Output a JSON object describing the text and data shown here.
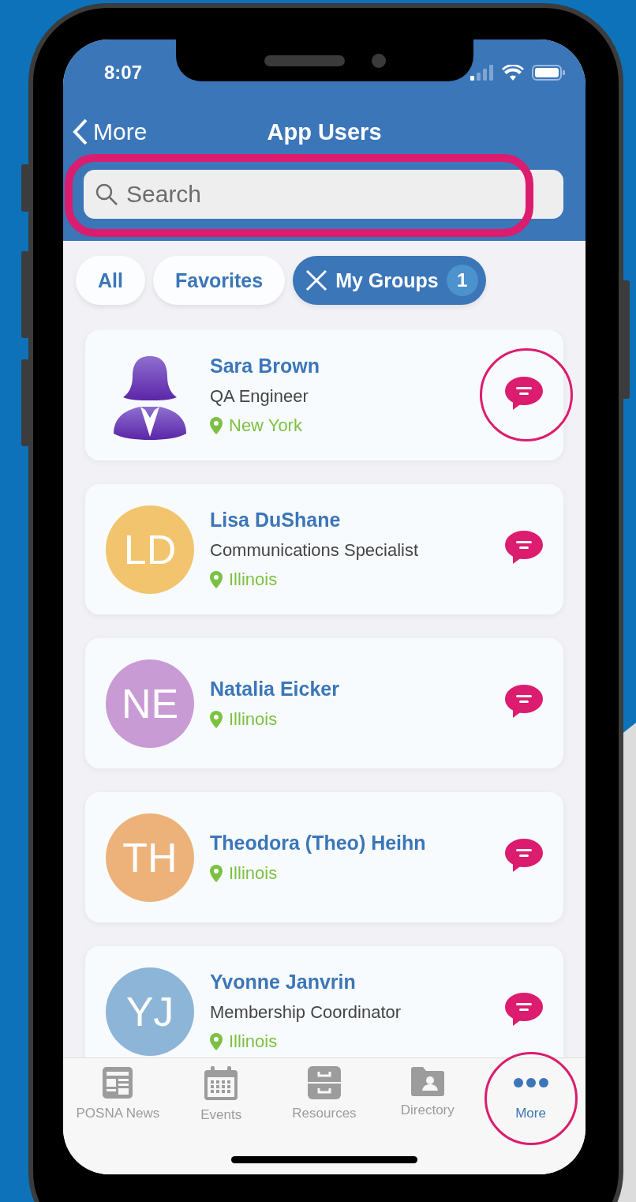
{
  "status_bar": {
    "time": "8:07"
  },
  "nav": {
    "back": "More",
    "title": "App Users"
  },
  "search": {
    "placeholder": "Search",
    "highlighted": true
  },
  "filters": [
    {
      "label": "All",
      "selected": false
    },
    {
      "label": "Favorites",
      "selected": false
    },
    {
      "label": "My Groups",
      "selected": true,
      "count": "1"
    }
  ],
  "users": [
    {
      "kind": "silhouette",
      "name": "Sara Brown",
      "title": "QA Engineer",
      "location": "New York",
      "highlighted": true
    },
    {
      "kind": "initials",
      "initials": "LD",
      "color": "#f2c46e",
      "name": "Lisa DuShane",
      "title": "Communications Specialist",
      "location": "Illinois",
      "highlighted": false
    },
    {
      "kind": "initials",
      "initials": "NE",
      "color": "#c99bd5",
      "name": "Natalia Eicker",
      "location": "Illinois",
      "highlighted": false
    },
    {
      "kind": "initials",
      "initials": "TH",
      "color": "#ecb27a",
      "name": "Theodora (Theo) Heihn",
      "location": "Illinois",
      "highlighted": false
    },
    {
      "kind": "initials",
      "initials": "YJ",
      "color": "#8db5d8",
      "name": "Yvonne Janvrin",
      "title": "Membership Coordinator",
      "location": "Illinois",
      "highlighted": false
    }
  ],
  "tabs": [
    {
      "kind": "news",
      "label": "POSNA News",
      "selected": false,
      "highlighted": false
    },
    {
      "kind": "calendar",
      "label": "Events",
      "selected": false,
      "highlighted": false
    },
    {
      "kind": "cabinet",
      "label": "Resources",
      "selected": false,
      "highlighted": false
    },
    {
      "kind": "folder",
      "label": "Directory",
      "selected": false,
      "highlighted": false
    },
    {
      "kind": "more",
      "label": "More",
      "selected": true,
      "highlighted": true
    }
  ]
}
